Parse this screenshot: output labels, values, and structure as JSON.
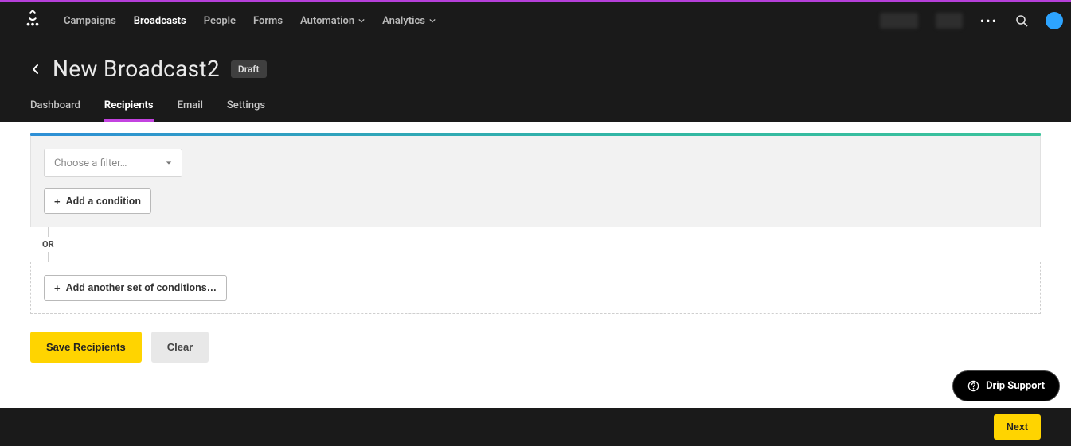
{
  "nav": {
    "items": [
      {
        "label": "Campaigns"
      },
      {
        "label": "Broadcasts"
      },
      {
        "label": "People"
      },
      {
        "label": "Forms"
      },
      {
        "label": "Automation"
      },
      {
        "label": "Analytics"
      }
    ]
  },
  "page": {
    "title": "New Broadcast2",
    "badge": "Draft"
  },
  "tabs": [
    {
      "label": "Dashboard"
    },
    {
      "label": "Recipients"
    },
    {
      "label": "Email"
    },
    {
      "label": "Settings"
    }
  ],
  "filter": {
    "dropdown_placeholder": "Choose a filter…",
    "add_condition_label": "Add a condition",
    "or_label": "OR",
    "add_set_label": "Add another set of conditions…"
  },
  "actions": {
    "save": "Save Recipients",
    "clear": "Clear",
    "next": "Next"
  },
  "support": {
    "label": "Drip Support"
  }
}
